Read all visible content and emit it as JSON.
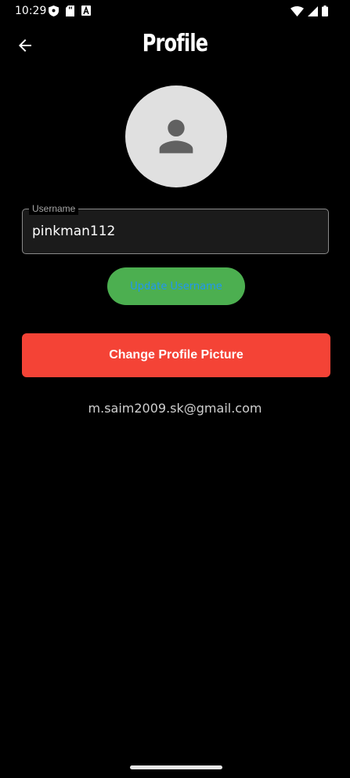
{
  "status_bar": {
    "time": "10:29",
    "icons_left": [
      "shield-icon",
      "sd-card-icon",
      "font-icon"
    ],
    "icons_right": [
      "wifi-icon",
      "signal-icon",
      "battery-icon"
    ]
  },
  "header": {
    "title": "Profile",
    "back_icon": "arrow-back-icon"
  },
  "avatar": {
    "icon": "person-icon"
  },
  "username": {
    "label": "Username",
    "value": "pinkman112"
  },
  "buttons": {
    "update_username": "Update Username",
    "change_picture": "Change Profile Picture"
  },
  "email": "m.saim2009.sk@gmail.com",
  "colors": {
    "background": "#000000",
    "update_button": "#4caf50",
    "update_button_text": "#2196f3",
    "change_picture_button": "#f44336",
    "avatar_bg": "#e0e0e0"
  }
}
